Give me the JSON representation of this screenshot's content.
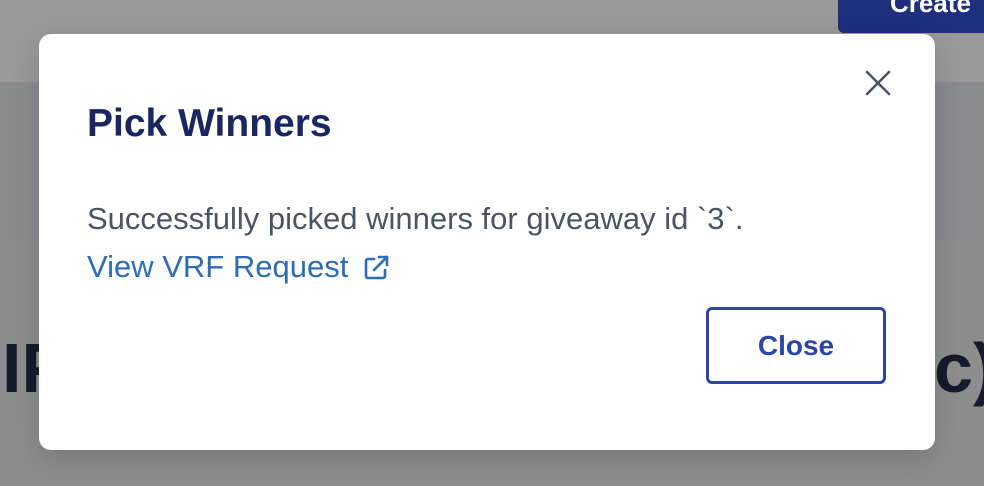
{
  "background": {
    "create_button_label": "Create",
    "heading_left_fragment": "IP",
    "heading_right_fragment": "c)"
  },
  "modal": {
    "title": "Pick Winners",
    "message": "Successfully picked winners for giveaway id `3`.",
    "vrf_link_label": "View VRF Request",
    "close_button_label": "Close",
    "icons": {
      "close": "close-icon",
      "external": "external-link-icon"
    },
    "colors": {
      "title": "#1a2661",
      "link": "#2c6cb8",
      "button_border": "#2a44a8",
      "overlay": "#8a8a8a"
    }
  }
}
